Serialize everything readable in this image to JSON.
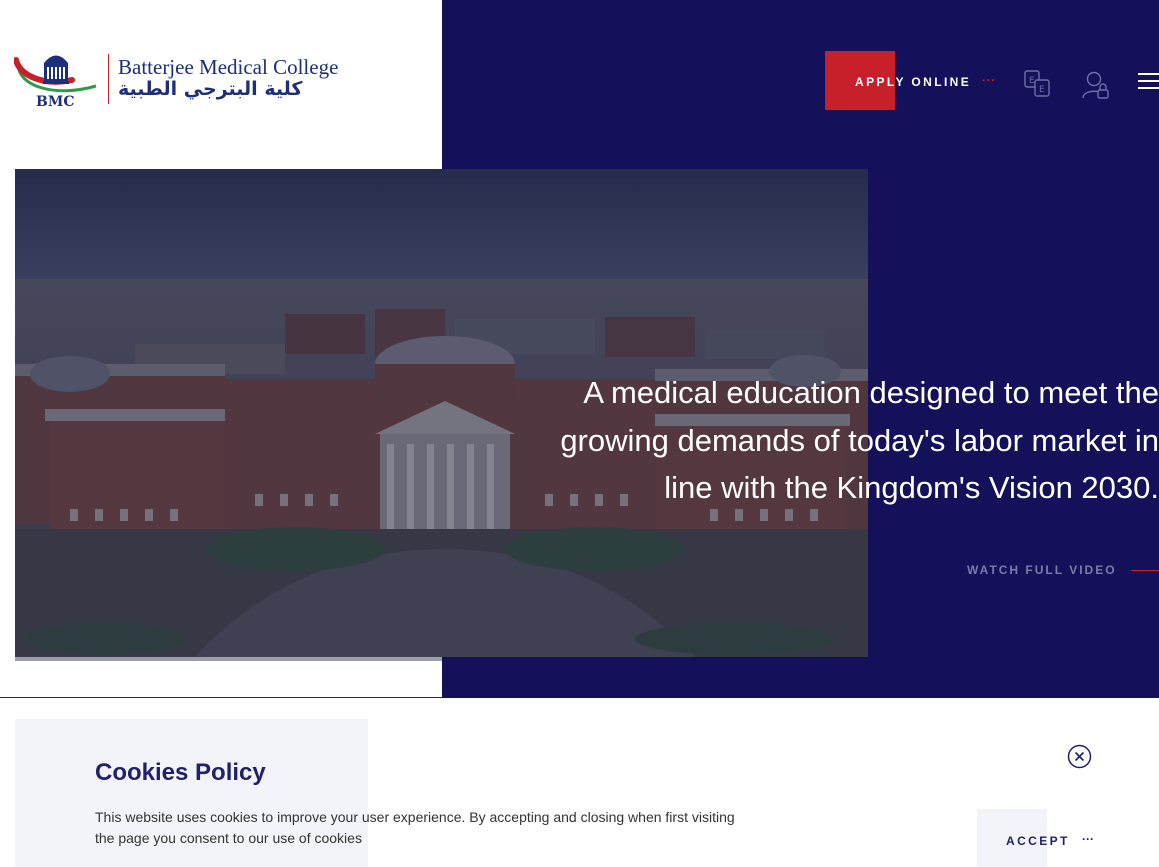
{
  "brand": {
    "abbr": "BMC",
    "name_en": "Batterjee Medical College",
    "name_ar": "كلية البترجي الطبية"
  },
  "header": {
    "apply_label": "APPLY ONLINE",
    "apply_dots": "···",
    "icons": [
      "language-switch-icon",
      "user-login-icon",
      "hamburger-menu-icon"
    ]
  },
  "hero": {
    "headline_lines": [
      "A medical education designed to meet the",
      "growing demands of today's labor market in",
      "line with the Kingdom's Vision 2030."
    ],
    "watch_label": "WATCH FULL VIDEO"
  },
  "cookie": {
    "title": "Cookies Policy",
    "text": "This website uses cookies to improve your user experience. By accepting and closing when first visiting the page you consent to our use of cookies",
    "accept_label": "ACCEPT",
    "accept_dots": "···"
  },
  "colors": {
    "navy": "#14105a",
    "accent_red": "#c8202a",
    "brand_blue": "#1c2f78",
    "cookie_title": "#21206d"
  }
}
